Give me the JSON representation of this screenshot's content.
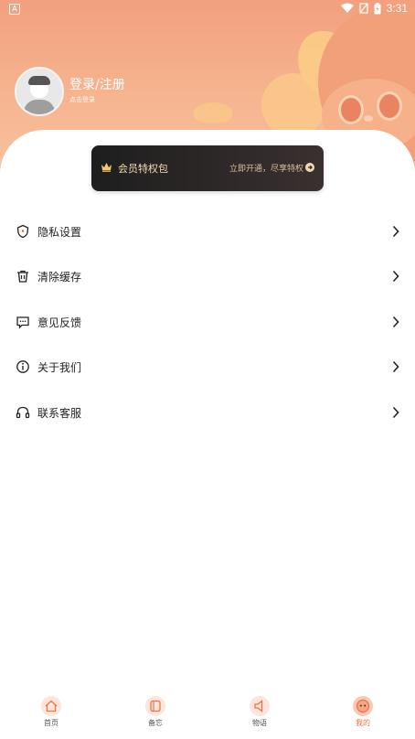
{
  "status_bar": {
    "left_icon": "A",
    "time": "3:31",
    "icons": [
      "wifi-icon",
      "signal-off-icon",
      "battery-icon"
    ]
  },
  "profile": {
    "title": "登录/注册",
    "subtitle": "点击登录"
  },
  "vip_banner": {
    "title": "会员特权包",
    "promo": "立即开通，尽享特权",
    "accent": "#f5dcb4"
  },
  "menu": {
    "items": [
      {
        "label": "隐私设置",
        "icon": "shield-icon"
      },
      {
        "label": "清除缓存",
        "icon": "trash-icon"
      },
      {
        "label": "意见反馈",
        "icon": "message-icon"
      },
      {
        "label": "关于我们",
        "icon": "info-icon"
      },
      {
        "label": "联系客服",
        "icon": "headset-icon"
      }
    ]
  },
  "bottom_nav": {
    "items": [
      {
        "label": "首页",
        "icon": "home-icon"
      },
      {
        "label": "备忘",
        "icon": "memo-icon"
      },
      {
        "label": "物语",
        "icon": "speaker-icon"
      },
      {
        "label": "我的",
        "icon": "profile-face-icon",
        "active": true
      }
    ],
    "active_color": "#e8734e"
  },
  "colors": {
    "header_gradient_top": "#f2a07e",
    "header_gradient_bottom": "#f9c8a5",
    "vip_background": "#1e1e1e"
  }
}
